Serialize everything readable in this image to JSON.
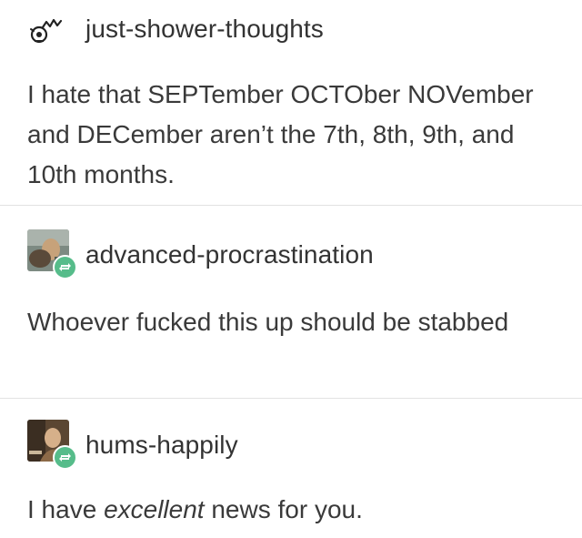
{
  "posts": [
    {
      "username": "just-shower-thoughts",
      "avatar_icon": "lightbulb-doodle-icon",
      "reblog": false,
      "body": "I hate that SEPTember OCTOber NOVember and DECember aren’t the 7th, 8th, 9th, and 10th months."
    },
    {
      "username": "advanced-procrastination",
      "avatar_icon": "user-photo-avatar",
      "reblog": true,
      "reblog_icon": "reblog-icon",
      "body": "Whoever fucked this up should be stabbed"
    },
    {
      "username": "hums-happily",
      "avatar_icon": "user-photo-avatar",
      "reblog": true,
      "reblog_icon": "reblog-icon",
      "body_before": "I have ",
      "body_emphasis": "excellent",
      "body_after": " news for you."
    }
  ],
  "colors": {
    "reblog_badge": "#56bc8a",
    "divider": "#e2e2e2",
    "text": "#3a3a3a"
  }
}
